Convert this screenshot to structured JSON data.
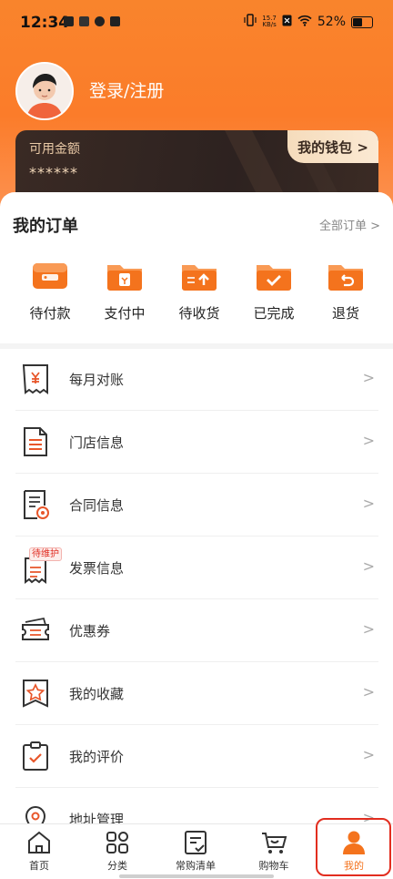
{
  "status_bar": {
    "time": "12:34",
    "net_speed_top": "15.7",
    "net_speed_bottom": "KB/s",
    "battery": "52%"
  },
  "profile": {
    "login_label": "登录/注册"
  },
  "wallet": {
    "available_label": "可用金额",
    "masked_amount": "******",
    "wallet_button": "我的钱包 >"
  },
  "orders": {
    "title": "我的订单",
    "all_orders": "全部订单 >",
    "items": [
      {
        "label": "待付款",
        "icon": "wallet-card-icon"
      },
      {
        "label": "支付中",
        "icon": "folder-pay-icon"
      },
      {
        "label": "待收货",
        "icon": "folder-upload-icon"
      },
      {
        "label": "已完成",
        "icon": "folder-check-icon"
      },
      {
        "label": "退货",
        "icon": "folder-return-icon"
      }
    ]
  },
  "menu": {
    "items": [
      {
        "label": "每月对账",
        "icon": "receipt-yen-icon"
      },
      {
        "label": "门店信息",
        "icon": "document-icon"
      },
      {
        "label": "合同信息",
        "icon": "contract-icon"
      },
      {
        "label": "发票信息",
        "icon": "invoice-icon",
        "tag": "待维护"
      },
      {
        "label": "优惠券",
        "icon": "coupon-icon"
      },
      {
        "label": "我的收藏",
        "icon": "star-bookmark-icon"
      },
      {
        "label": "我的评价",
        "icon": "clipboard-check-icon"
      },
      {
        "label": "地址管理",
        "icon": "location-pin-icon"
      }
    ],
    "arrow": ">"
  },
  "tabbar": {
    "tabs": [
      {
        "label": "首页",
        "icon": "home-icon"
      },
      {
        "label": "分类",
        "icon": "grid-icon"
      },
      {
        "label": "常购清单",
        "icon": "list-check-icon"
      },
      {
        "label": "购物车",
        "icon": "cart-icon"
      },
      {
        "label": "我的",
        "icon": "user-icon",
        "active": true
      }
    ]
  },
  "colors": {
    "brand_orange": "#f4731d",
    "highlight_red": "#e22d1f",
    "wallet_dark": "#2d2220"
  }
}
